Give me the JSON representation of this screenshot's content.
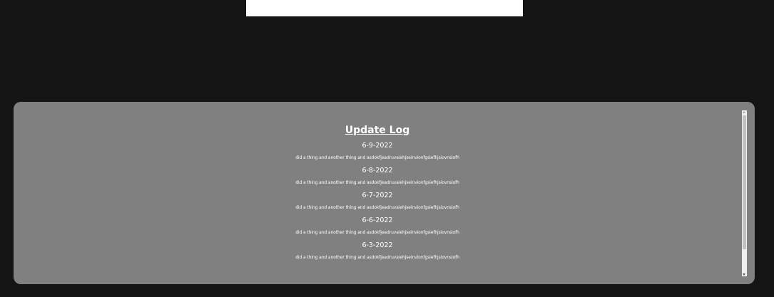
{
  "update_log": {
    "title": "Update Log",
    "entries": [
      {
        "date": "6-9-2022",
        "description": "did a thing and another thing and asdokfjeadruvaiehjseinvionfgsiefhjsiovnsiofh"
      },
      {
        "date": "6-8-2022",
        "description": "did a thing and another thing and asdokfjeadruvaiehjseinvionfgsiefhjsiovnsiofh"
      },
      {
        "date": "6-7-2022",
        "description": "did a thing and another thing and asdokfjeadruvaiehjseinvionfgsiefhjsiovnsiofh"
      },
      {
        "date": "6-6-2022",
        "description": "did a thing and another thing and asdokfjeadruvaiehjseinvionfgsiefhjsiovnsiofh"
      },
      {
        "date": "6-3-2022",
        "description": "did a thing and another thing and asdokfjeadruvaiehjseinvionfgsiefhjsiovnsiofh"
      }
    ]
  },
  "colors": {
    "background": "#141414",
    "panel": "#808080",
    "text": "#ffffff",
    "top_panel": "#ffffff"
  }
}
